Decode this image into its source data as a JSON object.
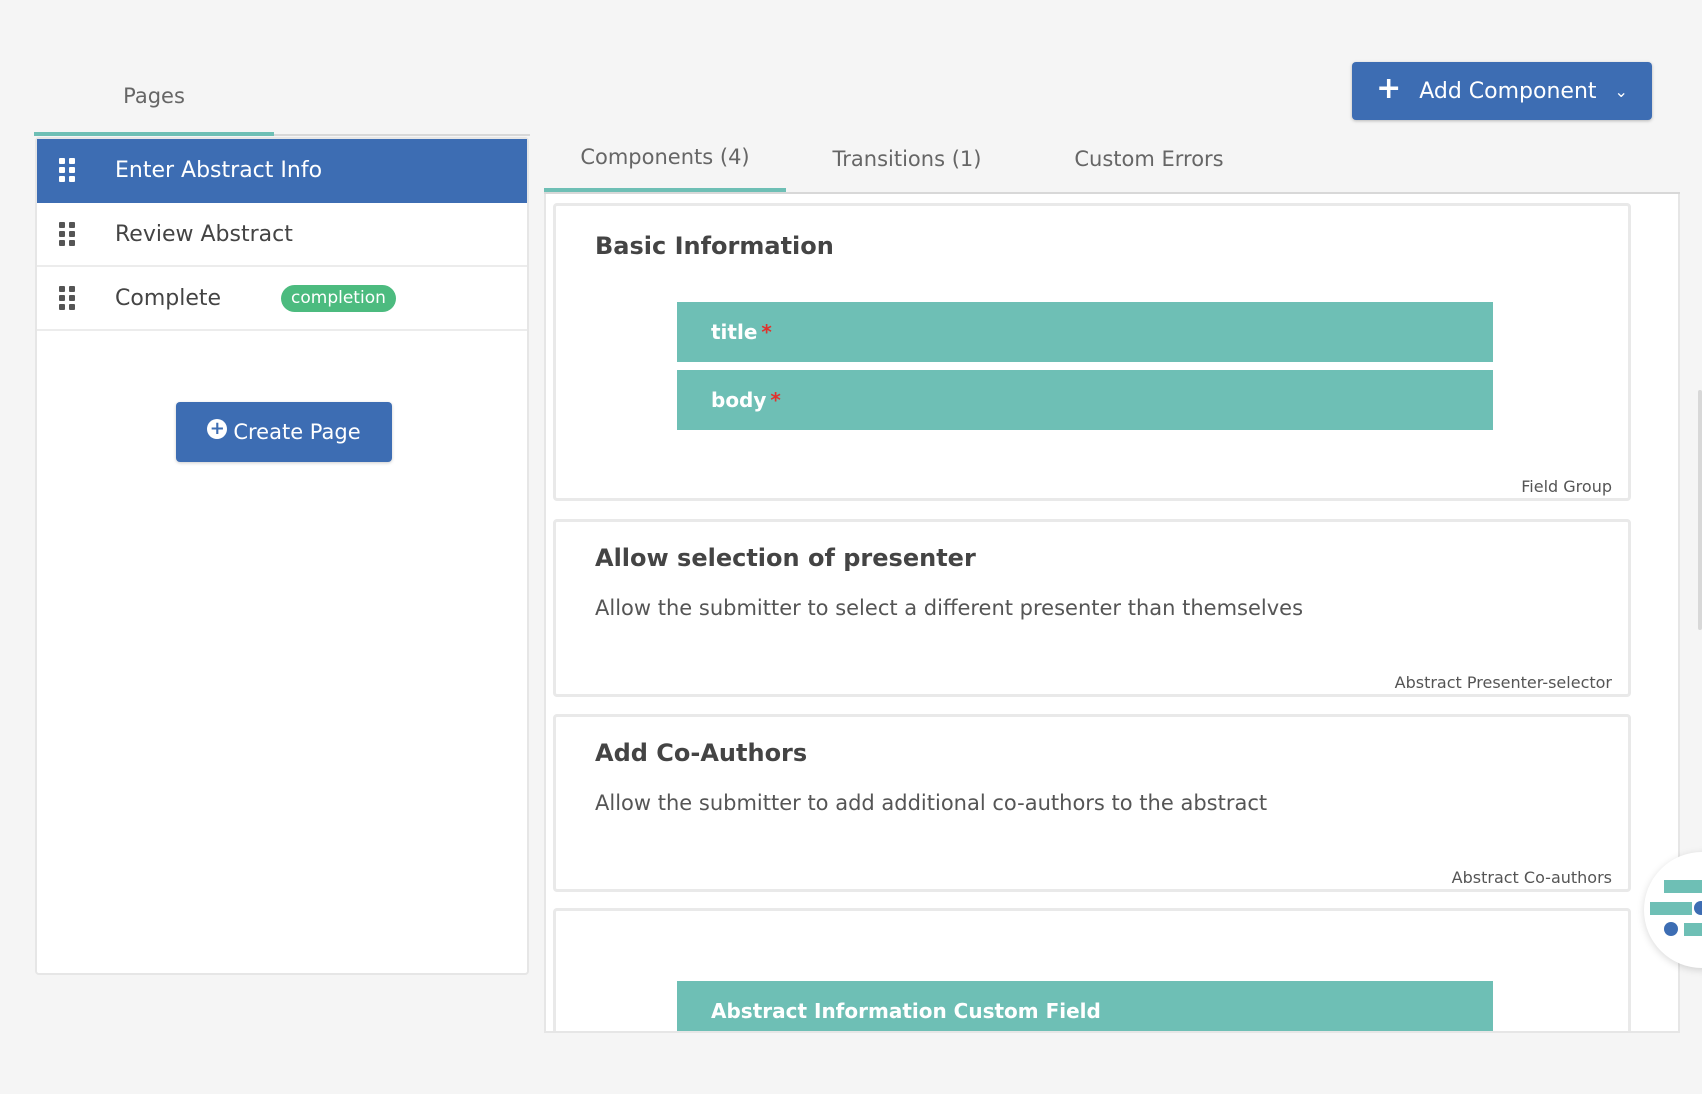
{
  "pages_panel": {
    "tab_label": "Pages",
    "items": [
      {
        "label": "Enter Abstract Info",
        "badge": ""
      },
      {
        "label": "Review Abstract",
        "badge": ""
      },
      {
        "label": "Complete",
        "badge": "completion"
      }
    ],
    "create_label": "Create Page"
  },
  "toolbar": {
    "add_component_label": "Add Component"
  },
  "main_tabs": [
    {
      "label": "Components (4)"
    },
    {
      "label": "Transitions (1)"
    },
    {
      "label": "Custom Errors"
    }
  ],
  "components": [
    {
      "title": "Basic Information",
      "type": "Field Group",
      "fields": [
        {
          "label": "title",
          "required_mark": "*"
        },
        {
          "label": "body",
          "required_mark": "*"
        }
      ]
    },
    {
      "title": "Allow selection of presenter",
      "description": "Allow the submitter to select a different presenter than themselves",
      "type": "Abstract Presenter-selector"
    },
    {
      "title": "Add Co-Authors",
      "description": "Allow the submitter to add additional co-authors to the abstract",
      "type": "Abstract Co-authors"
    },
    {
      "fields": [
        {
          "label": "Abstract Information Custom Field"
        }
      ]
    }
  ],
  "colors": {
    "primary": "#3d6db3",
    "accent_teal": "#6ebfb5",
    "badge_green": "#4cbb7f",
    "required_red": "#e0322d"
  }
}
